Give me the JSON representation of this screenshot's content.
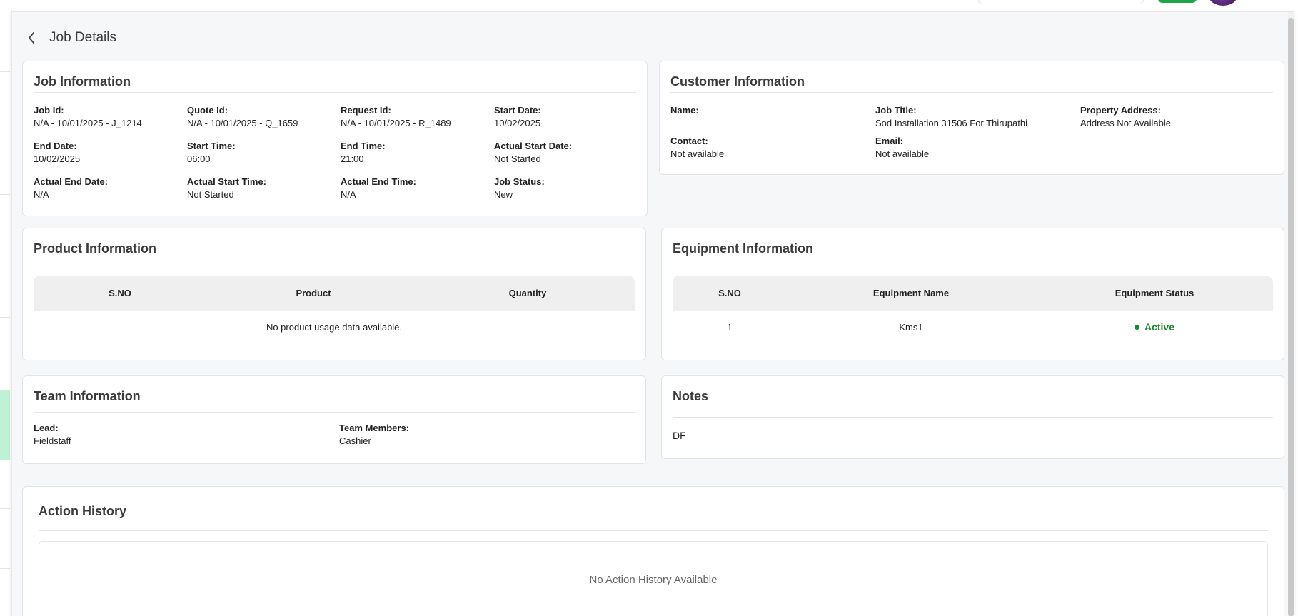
{
  "header": {
    "title": "Job Details"
  },
  "job_info": {
    "title": "Job Information",
    "fields": [
      {
        "label": "Job Id:",
        "value": "N/A - 10/01/2025 - J_1214"
      },
      {
        "label": "Quote Id:",
        "value": "N/A - 10/01/2025 - Q_1659"
      },
      {
        "label": "Request Id:",
        "value": "N/A - 10/01/2025 - R_1489"
      },
      {
        "label": "Start Date:",
        "value": "10/02/2025"
      },
      {
        "label": "End Date:",
        "value": "10/02/2025"
      },
      {
        "label": "Start Time:",
        "value": "06:00"
      },
      {
        "label": "End Time:",
        "value": "21:00"
      },
      {
        "label": "Actual Start Date:",
        "value": "Not Started"
      },
      {
        "label": "Actual End Date:",
        "value": "N/A"
      },
      {
        "label": "Actual Start Time:",
        "value": "Not Started"
      },
      {
        "label": "Actual End Time:",
        "value": "N/A"
      },
      {
        "label": "Job Status:",
        "value": "New"
      }
    ]
  },
  "customer_info": {
    "title": "Customer Information",
    "fields": [
      {
        "label": "Name:",
        "value": ""
      },
      {
        "label": "Job Title:",
        "value": "Sod Installation 31506 For Thirupathi"
      },
      {
        "label": "Property Address:",
        "value": "Address Not Available"
      },
      {
        "label": "Contact:",
        "value": "Not available"
      },
      {
        "label": "Email:",
        "value": "Not available"
      }
    ]
  },
  "product_info": {
    "title": "Product Information",
    "columns": [
      "S.NO",
      "Product",
      "Quantity"
    ],
    "empty_message": "No product usage data available."
  },
  "equipment_info": {
    "title": "Equipment Information",
    "columns": [
      "S.NO",
      "Equipment Name",
      "Equipment Status"
    ],
    "rows": [
      {
        "sno": "1",
        "name": "Kms1",
        "status": "Active"
      }
    ],
    "status_color": "#1b8a2c"
  },
  "team_info": {
    "title": "Team Information",
    "fields": [
      {
        "label": "Lead:",
        "value": "Fieldstaff"
      },
      {
        "label": "Team Members:",
        "value": "Cashier"
      }
    ]
  },
  "notes": {
    "title": "Notes",
    "text": "DF"
  },
  "action_history": {
    "title": "Action History",
    "empty_message": "No Action History Available"
  }
}
